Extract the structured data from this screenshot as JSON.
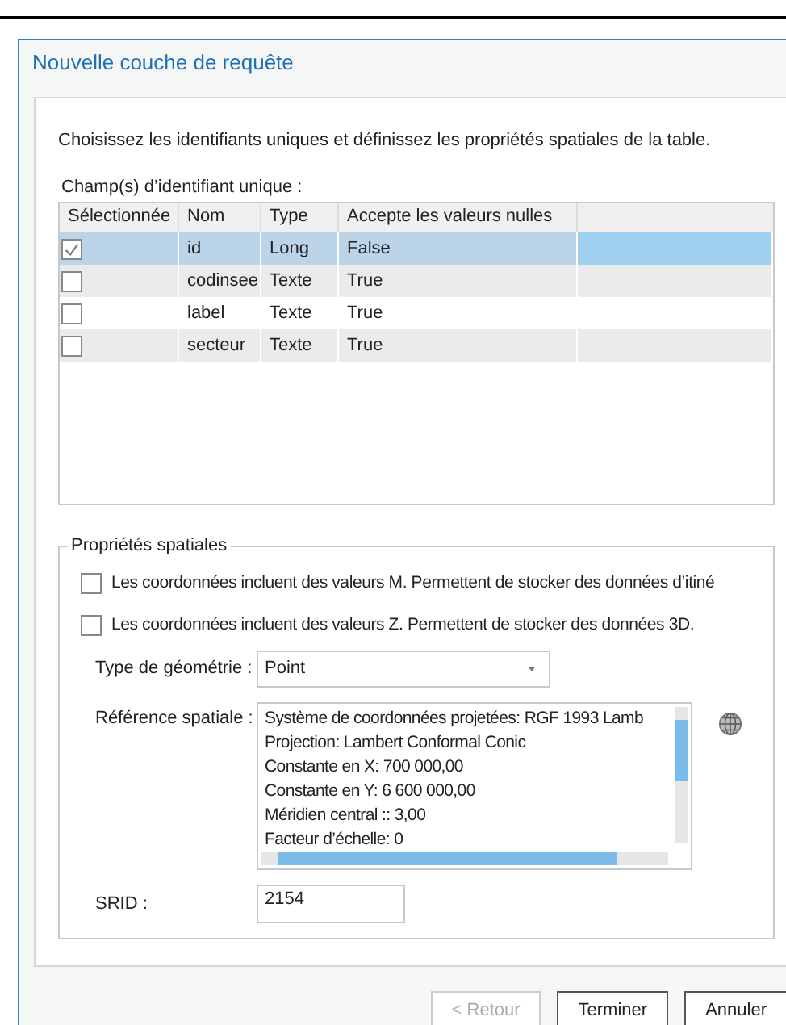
{
  "window": {
    "title": "Nouvelle couche de requête"
  },
  "instructions": "Choisissez les identifiants uniques et définissez les propriétés spatiales de la table.",
  "id_fields": {
    "label": "Champ(s) d’identifiant unique :",
    "columns": [
      "Sélectionnée",
      "Nom",
      "Type",
      "Accepte les valeurs nulles"
    ],
    "rows": [
      {
        "checked": true,
        "selected": true,
        "name": "id",
        "type": "Long",
        "nullable": "False"
      },
      {
        "checked": false,
        "selected": false,
        "name": "codinsee",
        "type": "Texte",
        "nullable": "True"
      },
      {
        "checked": false,
        "selected": false,
        "name": "label",
        "type": "Texte",
        "nullable": "True"
      },
      {
        "checked": false,
        "selected": false,
        "name": "secteur",
        "type": "Texte",
        "nullable": "True"
      }
    ]
  },
  "spatial": {
    "legend": "Propriétés spatiales",
    "options": [
      {
        "label": "Les coordonnées incluent des valeurs M. Permettent de stocker des données d’itiné",
        "checked": false
      },
      {
        "label": "Les coordonnées incluent des valeurs Z. Permettent de stocker des données 3D.",
        "checked": false
      }
    ],
    "geometry_type": {
      "label": "Type de géométrie :",
      "value": "Point"
    },
    "spatial_reference": {
      "label": "Référence spatiale :",
      "lines": [
        "Système de coordonnées projetées:  RGF 1993 Lamb",
        "Projection:  Lambert Conformal Conic",
        "Constante en X:  700 000,00",
        "Constante en Y:  6 600 000,00",
        "Méridien central ::  3,00",
        "Facteur d’échelle:  0"
      ]
    },
    "srid": {
      "label": "SRID :",
      "value": "2154"
    }
  },
  "buttons": [
    {
      "label": "< Retour",
      "disabled": true
    },
    {
      "label": "Terminer",
      "disabled": false
    },
    {
      "label": "Annuler",
      "disabled": false
    }
  ]
}
